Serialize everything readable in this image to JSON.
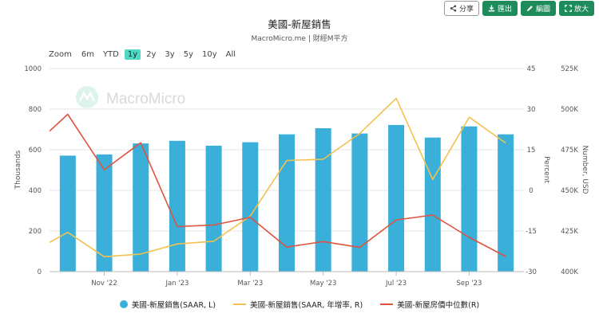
{
  "toolbar": {
    "share_label": "分享",
    "export_label": "匯出",
    "edit_label": "編圖",
    "expand_label": "放大"
  },
  "zoom": {
    "label": "Zoom",
    "options": [
      "6m",
      "YTD",
      "1y",
      "2y",
      "3y",
      "5y",
      "10y",
      "All"
    ],
    "active": "1y"
  },
  "watermark": "MacroMicro",
  "colors": {
    "bar": "#3aafd9",
    "yoy": "#f2c14e",
    "price": "#e0533f",
    "accent": "#1e8b5b"
  },
  "chart_data": {
    "type": "bar",
    "title": "美國-新屋銷售",
    "subtitle": "MacroMicro.me | 財經M平方",
    "x_ticks": [
      "Nov '22",
      "Jan '23",
      "Mar '23",
      "May '23",
      "Jul '23",
      "Sep '23"
    ],
    "x_tick_positions": [
      1.5,
      3.5,
      5.5,
      7.5,
      9.5,
      11.5
    ],
    "axes": {
      "left": {
        "label": "Thousands",
        "min": 0,
        "max": 1000,
        "ticks": [
          "0",
          "200",
          "400",
          "600",
          "800",
          "1000"
        ]
      },
      "right1": {
        "label": "Percent",
        "min": -30,
        "max": 45,
        "ticks": [
          "-30",
          "-15",
          "0",
          "15",
          "30",
          "45"
        ]
      },
      "right2": {
        "label": "Number, USD",
        "min": 400,
        "max": 525,
        "ticks": [
          "400K",
          "425K",
          "450K",
          "475K",
          "500K",
          "525K"
        ]
      }
    },
    "grid": true,
    "legend_position": "bottom",
    "series": [
      {
        "name": "美國-新屋銷售(SAAR, L)",
        "type": "bar",
        "axis": "left",
        "x": [
          0.5,
          1.5,
          2.5,
          3.5,
          4.5,
          5.5,
          6.5,
          7.5,
          8.5,
          9.5,
          10.5,
          11.5,
          12.5
        ],
        "values": [
          571,
          577,
          631,
          644,
          620,
          637,
          676,
          706,
          680,
          722,
          660,
          715,
          676
        ]
      },
      {
        "name": "美國-新屋銷售(SAAR, 年增率, R)",
        "type": "line",
        "axis": "right1",
        "x": [
          0,
          0.5,
          1.5,
          2.5,
          3.5,
          4.5,
          5.5,
          6.5,
          7.5,
          8.5,
          9.5,
          10.5,
          11.5,
          12.5
        ],
        "values": [
          -19.2,
          -15.5,
          -24.5,
          -23.5,
          -19.8,
          -18.8,
          -9.5,
          11,
          11.5,
          21,
          34,
          4,
          27,
          17.5
        ]
      },
      {
        "name": "美國-新屋房價中位數(R)",
        "type": "line",
        "axis": "right2",
        "x": [
          0,
          0.5,
          1.5,
          2.5,
          3.5,
          4.5,
          5.5,
          6.5,
          7.5,
          8.5,
          9.5,
          10.5,
          11.5,
          12.5
        ],
        "values": [
          486.4,
          496.8,
          462.7,
          479.3,
          427.7,
          428.7,
          433.4,
          415.1,
          418.5,
          414.9,
          431.8,
          434.8,
          421.1,
          409.3
        ]
      }
    ]
  }
}
